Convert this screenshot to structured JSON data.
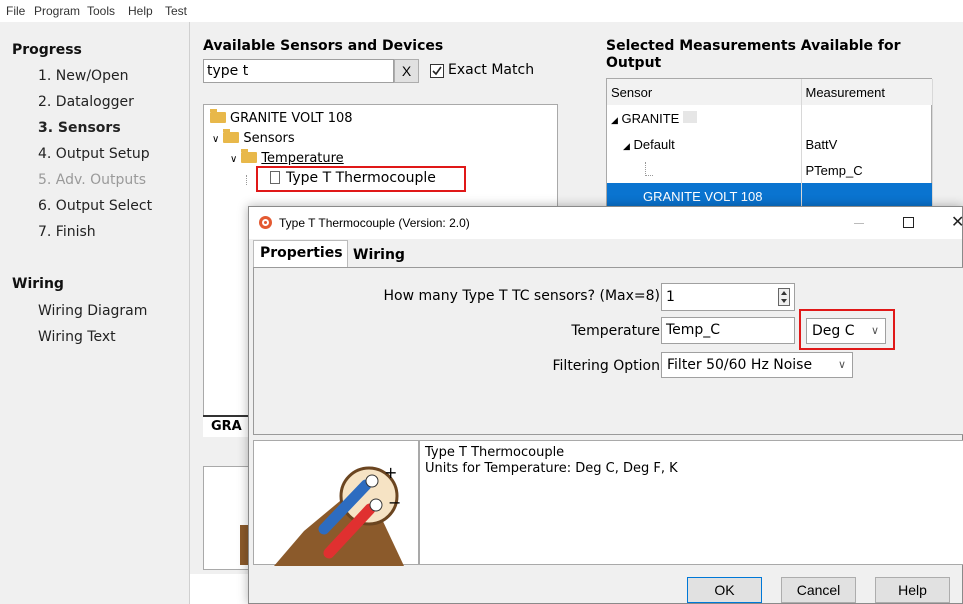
{
  "menu": [
    "File",
    "Program",
    "Tools",
    "Help",
    "Test"
  ],
  "progress": {
    "title": "Progress",
    "steps": [
      "1. New/Open",
      "2. Datalogger",
      "3. Sensors",
      "4. Output Setup",
      "5. Adv. Outputs",
      "6. Output Select",
      "7. Finish"
    ]
  },
  "wiring": {
    "title": "Wiring",
    "items": [
      "Wiring Diagram",
      "Wiring Text"
    ]
  },
  "available": {
    "title": "Available Sensors and Devices",
    "search_value": "type t",
    "clear_label": "X",
    "exact_match_label": "Exact Match",
    "tree": {
      "root": "GRANITE VOLT 108",
      "sensors": "Sensors",
      "temperature": "Temperature",
      "leaf": "Type T Thermocouple"
    },
    "bottom_tab_partial": "GRA"
  },
  "selected": {
    "title_line1": "Selected Measurements Available for",
    "title_line2": "Output",
    "col_sensor": "Sensor",
    "col_measurement": "Measurement",
    "rows": [
      {
        "sensor": "GRANITE",
        "measurement": ""
      },
      {
        "sensor": "Default",
        "measurement": "BattV"
      },
      {
        "sensor": "",
        "measurement": "PTemp_C"
      },
      {
        "sensor": "GRANITE VOLT 108",
        "measurement": ""
      }
    ]
  },
  "dialog": {
    "title": "Type T Thermocouple (Version: 2.0)",
    "tabs": [
      "Properties",
      "Wiring"
    ],
    "fields": {
      "count_label": "How many Type T TC sensors? (Max=8)",
      "count_value": "1",
      "temp_label": "Temperature",
      "temp_value": "Temp_C",
      "units_value": "Deg C",
      "filter_label": "Filtering Option",
      "filter_value": "Filter 50/60 Hz Noise"
    },
    "description_line1": "Type T Thermocouple",
    "description_line2": "Units for Temperature: Deg C, Deg F, K",
    "plus": "+",
    "minus": "−",
    "buttons": {
      "ok": "OK",
      "cancel": "Cancel",
      "help": "Help"
    }
  }
}
